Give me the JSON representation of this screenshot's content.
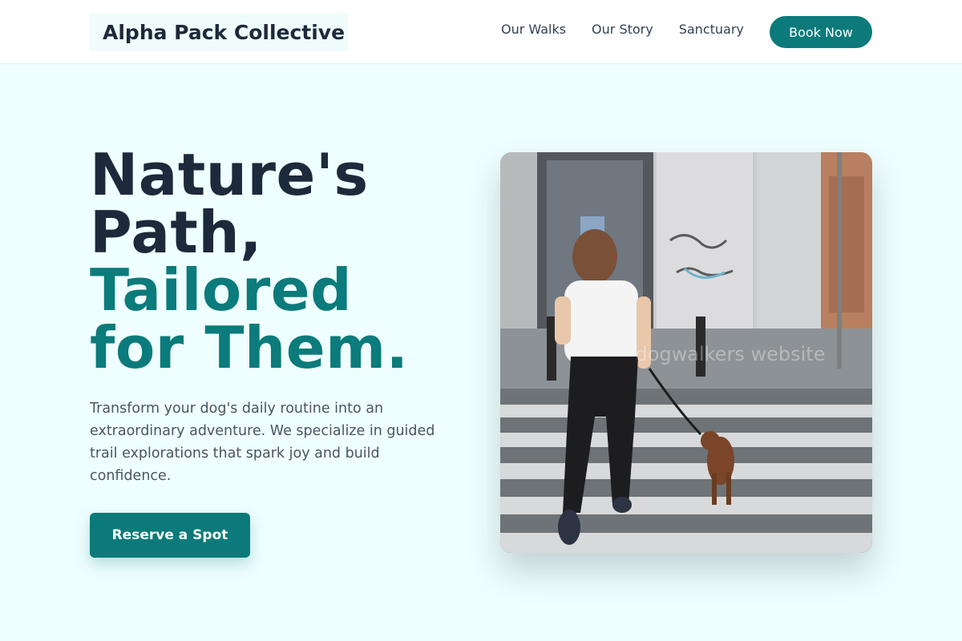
{
  "header": {
    "logo": "Alpha Pack Collective",
    "nav": [
      "Our Walks",
      "Our Story",
      "Sanctuary"
    ],
    "cta": "Book Now"
  },
  "hero": {
    "title_line1": "Nature's",
    "title_line2": "Path,",
    "title_line3": "Tailored",
    "title_line4": "for Them.",
    "description": "Transform your dog's daily routine into an extraordinary adventure. We specialize in guided trail explorations that spark joy and build confidence.",
    "cta": "Reserve a Spot",
    "image_watermark": "dogwalkers website"
  },
  "colors": {
    "accent": "#0c7a7a",
    "page_bg": "#effefe",
    "heading": "#1e293b"
  }
}
